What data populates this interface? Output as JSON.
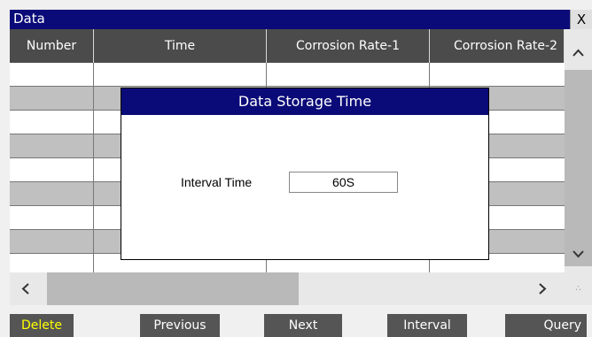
{
  "window": {
    "title": "Data",
    "close_label": "X"
  },
  "table": {
    "columns": [
      "Number",
      "Time",
      "Corrosion Rate-1",
      "Corrosion Rate-2"
    ],
    "rows": [
      [
        "",
        "",
        "",
        ""
      ],
      [
        "",
        "",
        "",
        ""
      ],
      [
        "",
        "",
        "",
        ""
      ],
      [
        "",
        "",
        "",
        ""
      ],
      [
        "",
        "",
        "",
        ""
      ],
      [
        "",
        "",
        "",
        ""
      ],
      [
        "",
        "",
        "",
        ""
      ],
      [
        "",
        "",
        "",
        ""
      ],
      [
        "",
        "",
        "",
        ""
      ]
    ]
  },
  "scroll": {
    "up": "^",
    "down": "v",
    "left": "<",
    "right": ">"
  },
  "dialog": {
    "title": "Data Storage Time",
    "label": "Interval Time",
    "value": "60S"
  },
  "buttons": {
    "delete": "Delete",
    "previous": "Previous",
    "next": "Next",
    "interval": "Interval",
    "query": "Query"
  },
  "colors": {
    "title_bar": "#0a0a78",
    "header": "#4b4b4b",
    "delete_text": "#ffff00",
    "button": "#555555"
  }
}
